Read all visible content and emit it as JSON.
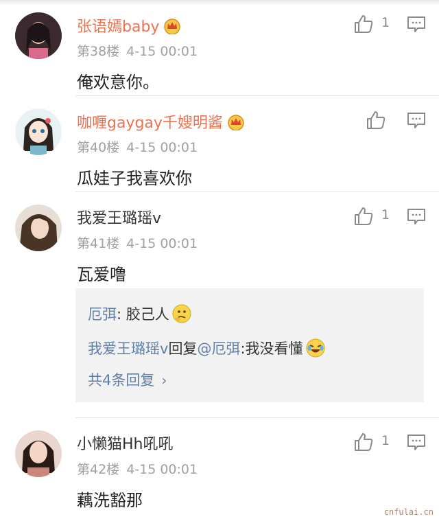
{
  "comments": [
    {
      "username": "张语嫣baby",
      "floor": "第38楼",
      "time": "4-15 00:01",
      "text": "俺欢意你。",
      "likes": "1",
      "vip": true,
      "avatar_palette": "#d86b8c"
    },
    {
      "username": "咖喱gaygay千嫂明酱",
      "floor": "第40楼",
      "time": "4-15 00:01",
      "text": "瓜娃子我喜欢你",
      "likes": "",
      "vip": true,
      "avatar_palette": "#7bb8c9"
    },
    {
      "username": "我爱王璐瑶v",
      "floor": "第41楼",
      "time": "4-15 00:01",
      "text": "瓦爱噜",
      "likes": "1",
      "vip": false,
      "avatar_palette": "#b89a84",
      "replies": [
        {
          "user": "厄弭",
          "sep": ":",
          "text": " 胶己人",
          "emoji": "thinking-emoji"
        },
        {
          "user": "我爱王璐瑶v",
          "middle": "回复",
          "target": "@厄弭",
          "sep": ":",
          "text": "我没看懂",
          "emoji": "laughing-tears-emoji"
        }
      ],
      "more_replies": "共4条回复"
    },
    {
      "username": "小懒猫Hh吼吼",
      "floor": "第42楼",
      "time": "4-15 00:01",
      "text": "藕洗豁那",
      "likes": "1",
      "vip": false,
      "avatar_palette": "#c9877a"
    }
  ],
  "watermark": "cnfulai.cn",
  "colors": {
    "vip_name": "#eb7350",
    "link": "#5f7fa9",
    "meta": "#a0a0a0",
    "reply_bg": "#f2f2f2"
  },
  "icons": {
    "like": "thumbs-up-icon",
    "reply": "comment-icon",
    "vip": "crown-icon"
  }
}
